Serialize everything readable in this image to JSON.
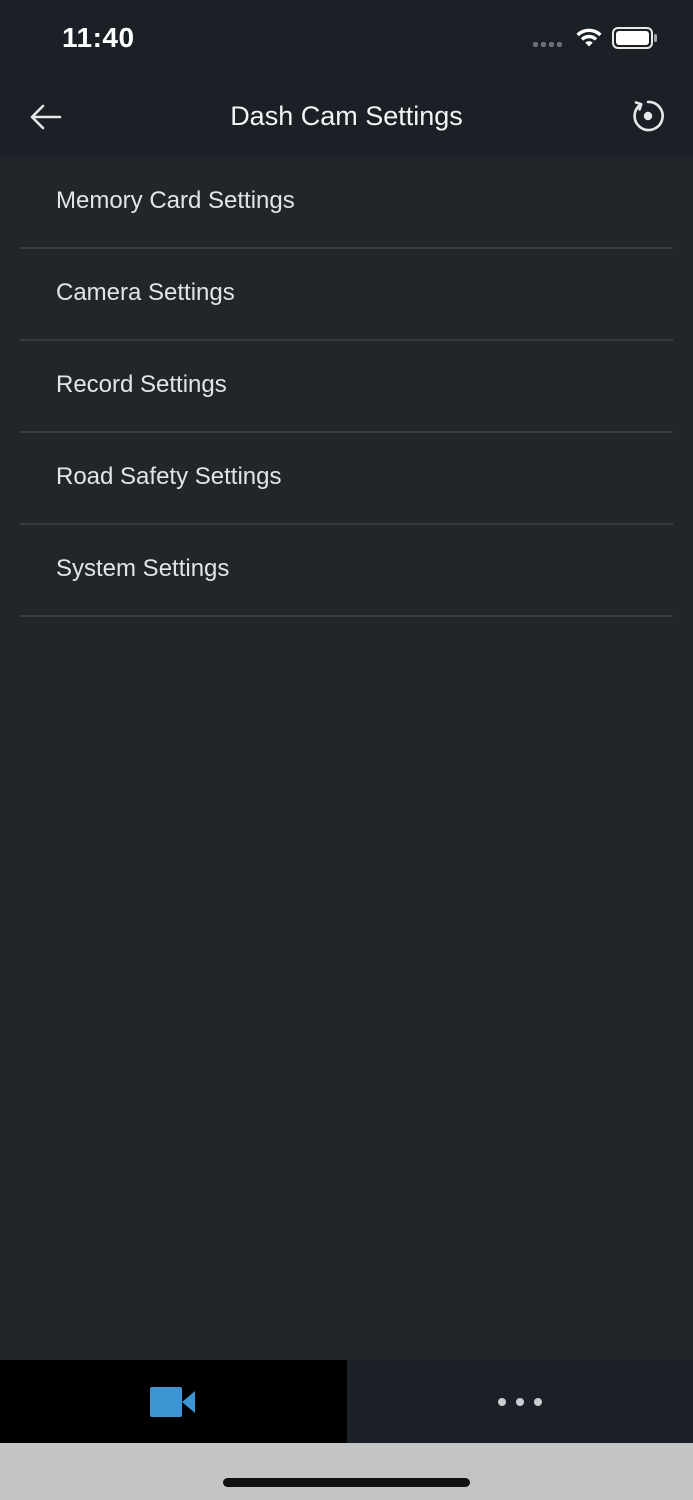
{
  "status_bar": {
    "time": "11:40"
  },
  "header": {
    "title": "Dash Cam Settings",
    "back_icon": "arrow-left-icon",
    "reset_icon": "reset-icon"
  },
  "settings": {
    "items": [
      {
        "label": "Memory Card Settings"
      },
      {
        "label": "Camera Settings"
      },
      {
        "label": "Record Settings"
      },
      {
        "label": "Road Safety Settings"
      },
      {
        "label": "System Settings"
      }
    ]
  },
  "tab_bar": {
    "tabs": [
      {
        "icon": "video-camera-icon",
        "active": true
      },
      {
        "icon": "more-icon",
        "active": false
      }
    ]
  },
  "colors": {
    "background": "#22252a",
    "header_background": "#1b1f26",
    "accent_blue": "#3d95d3",
    "divider": "#363a41",
    "text": "#e2e4e7"
  }
}
